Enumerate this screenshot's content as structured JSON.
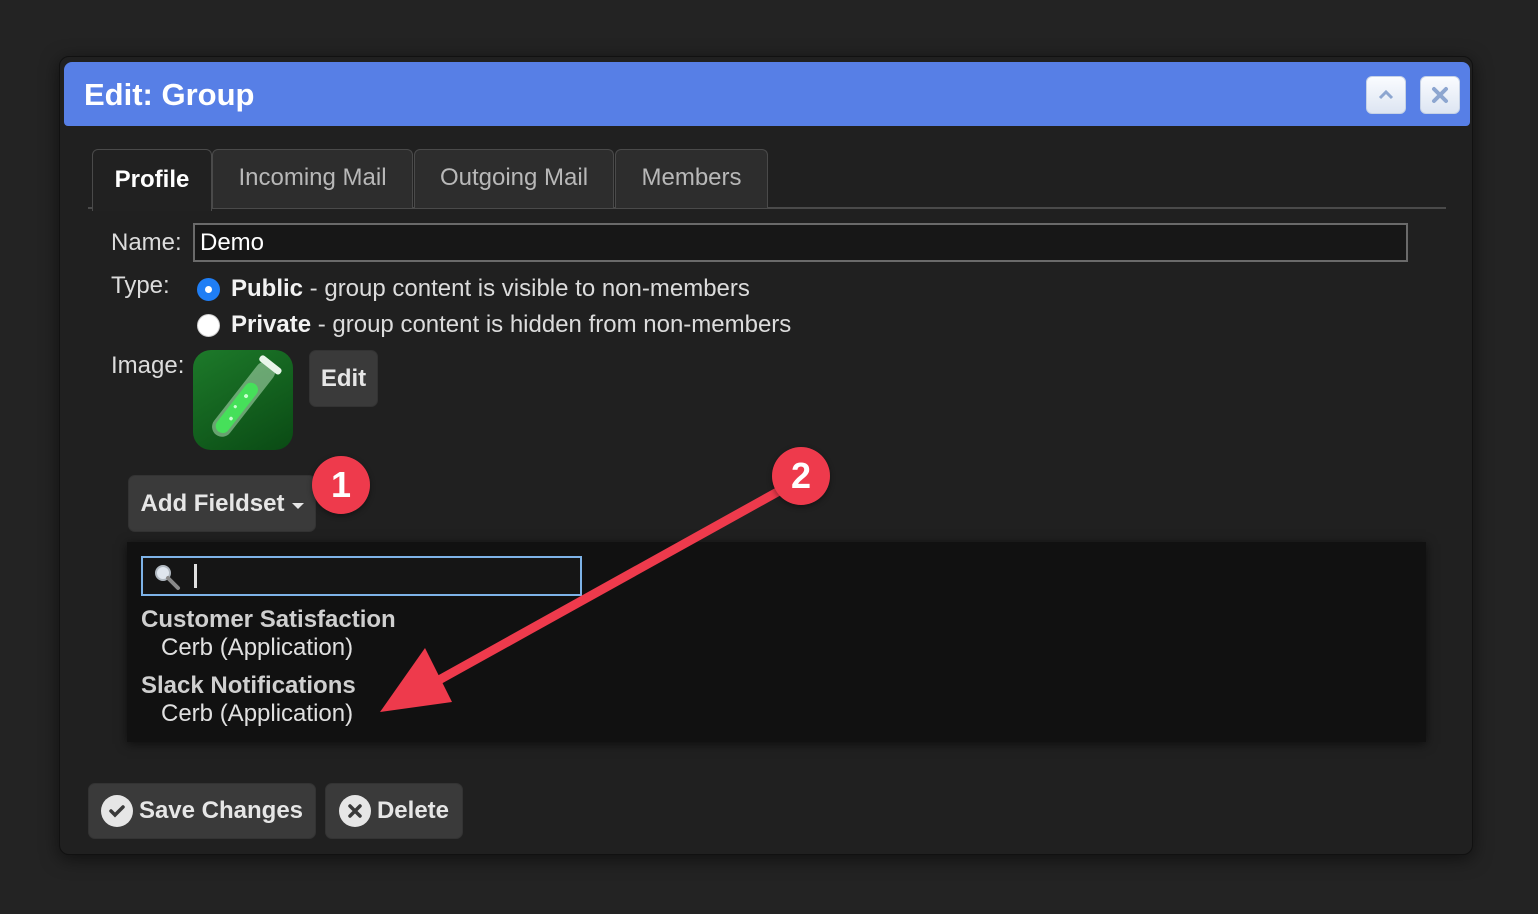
{
  "dialog": {
    "title": "Edit: Group",
    "collapse_icon": "chevron-up-icon",
    "close_icon": "close-icon"
  },
  "tabs": [
    {
      "label": "Profile",
      "active": true
    },
    {
      "label": "Incoming Mail",
      "active": false
    },
    {
      "label": "Outgoing Mail",
      "active": false
    },
    {
      "label": "Members",
      "active": false
    }
  ],
  "form": {
    "name_label": "Name:",
    "name_value": "Demo",
    "type_label": "Type:",
    "types": [
      {
        "title": "Public",
        "desc": " - group content is visible to non-members",
        "selected": true
      },
      {
        "title": "Private",
        "desc": " - group content is hidden from non-members",
        "selected": false
      }
    ],
    "image_label": "Image:",
    "image_icon": "test-tube-icon",
    "edit_label": "Edit"
  },
  "fieldset": {
    "button_label": "Add Fieldset",
    "search_value": "",
    "search_icon": "magnifier-icon",
    "options": [
      {
        "title": "Customer Satisfaction",
        "subtitle": "Cerb (Application)"
      },
      {
        "title": "Slack Notifications",
        "subtitle": "Cerb (Application)"
      }
    ]
  },
  "actions": {
    "save_label": "Save Changes",
    "delete_label": "Delete"
  },
  "annotations": {
    "badge_1": "1",
    "badge_2": "2",
    "color": "#ee3a4c"
  },
  "colors": {
    "titlebar": "#577fe6",
    "radio_selected": "#1f7ef5",
    "search_border": "#7eb3e8"
  }
}
